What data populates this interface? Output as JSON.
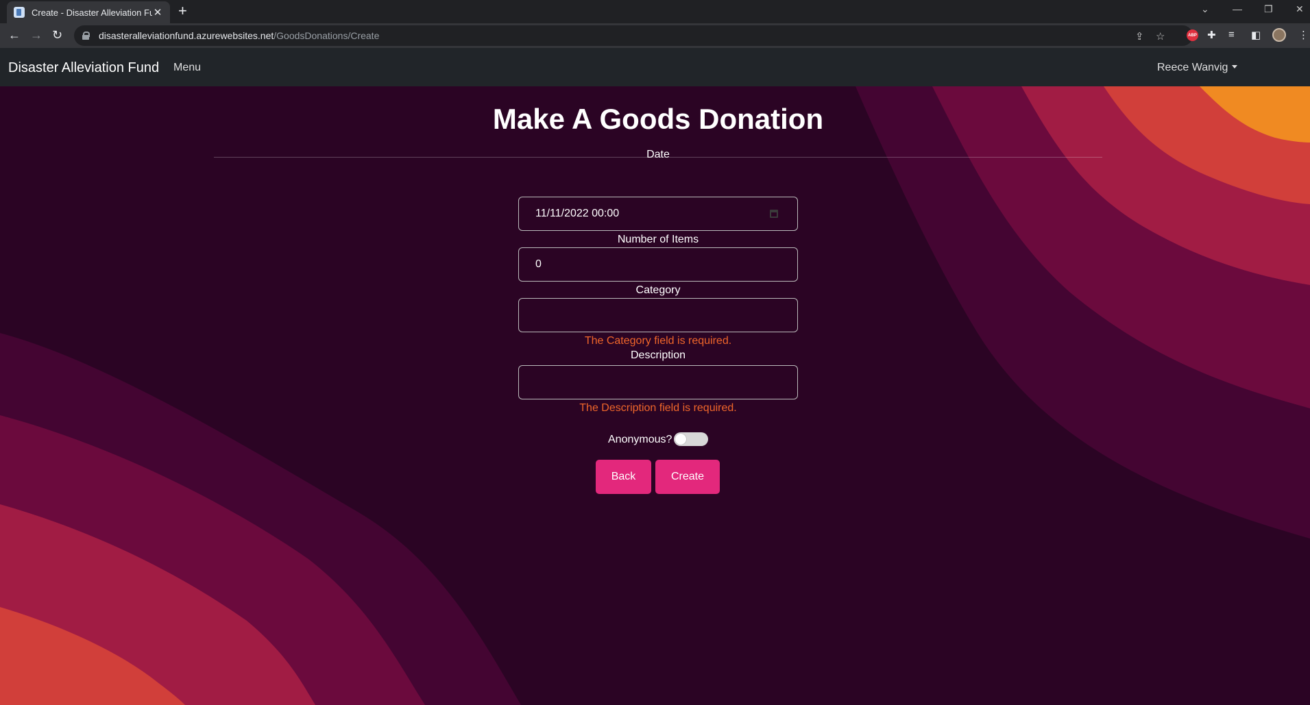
{
  "browser": {
    "tab_title": "Create - Disaster Alleviation Fund",
    "url_host": "disasteralleviationfund.azurewebsites.net",
    "url_path": "/GoodsDonations/Create",
    "abp_label": "ABP"
  },
  "navbar": {
    "brand": "Disaster Alleviation Fund",
    "menu": "Menu",
    "user": "Reece Wanvig"
  },
  "form": {
    "title": "Make A Goods Donation",
    "date": {
      "label": "Date",
      "value": "11/11/2022 00:00"
    },
    "number_of_items": {
      "label": "Number of Items",
      "value": "0"
    },
    "category": {
      "label": "Category",
      "value": "",
      "error": "The Category field is required."
    },
    "description": {
      "label": "Description",
      "value": "",
      "error": "The Description field is required."
    },
    "anonymous": {
      "label": "Anonymous?",
      "checked": false
    },
    "back_label": "Back",
    "create_label": "Create"
  },
  "colors": {
    "button": "#e3287c",
    "error": "#f0662a",
    "navbar": "#212529"
  }
}
